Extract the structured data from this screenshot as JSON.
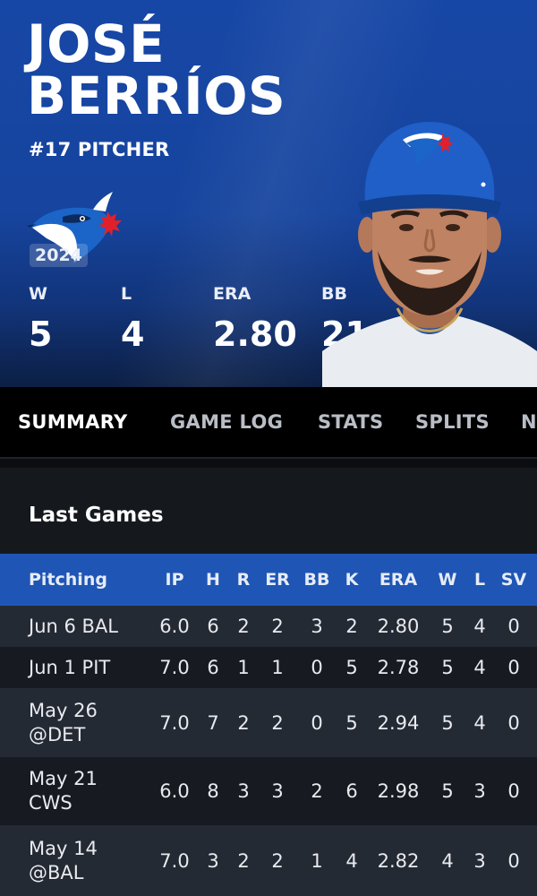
{
  "player": {
    "first_name": "JOSÉ",
    "last_name": "BERRÍOS",
    "meta": "#17 PITCHER",
    "team_logo_icon": "blue-jays-logo-icon",
    "headshot_icon": "player-headshot-icon"
  },
  "season": {
    "year": "2024"
  },
  "summary_stats": [
    {
      "label": "W",
      "value": "5"
    },
    {
      "label": "L",
      "value": "4"
    },
    {
      "label": "ERA",
      "value": "2.80"
    },
    {
      "label": "BB",
      "value": "21"
    }
  ],
  "tabs": [
    {
      "label": "SUMMARY",
      "active": true
    },
    {
      "label": "GAME LOG"
    },
    {
      "label": "STATS"
    },
    {
      "label": "SPLITS"
    },
    {
      "label": "N"
    }
  ],
  "last_games": {
    "title": "Last Games",
    "columns": [
      "Pitching",
      "IP",
      "H",
      "R",
      "ER",
      "BB",
      "K",
      "ERA",
      "W",
      "L",
      "SV"
    ],
    "rows": [
      {
        "game_lines": [
          "Jun 6 BAL"
        ],
        "cells": [
          "6.0",
          "6",
          "2",
          "2",
          "3",
          "2",
          "2.80",
          "5",
          "4",
          "0"
        ]
      },
      {
        "game_lines": [
          "Jun 1 PIT"
        ],
        "cells": [
          "7.0",
          "6",
          "1",
          "1",
          "0",
          "5",
          "2.78",
          "5",
          "4",
          "0"
        ]
      },
      {
        "game_lines": [
          "May 26",
          "@DET"
        ],
        "cells": [
          "7.0",
          "7",
          "2",
          "2",
          "0",
          "5",
          "2.94",
          "5",
          "4",
          "0"
        ]
      },
      {
        "game_lines": [
          "May 21",
          "CWS"
        ],
        "cells": [
          "6.0",
          "8",
          "3",
          "3",
          "2",
          "6",
          "2.98",
          "5",
          "3",
          "0"
        ]
      },
      {
        "game_lines": [
          "May 14",
          "@BAL"
        ],
        "cells": [
          "7.0",
          "3",
          "2",
          "2",
          "1",
          "4",
          "2.82",
          "4",
          "3",
          "0"
        ]
      }
    ]
  },
  "colors": {
    "header_blue": "#1747a6",
    "table_header_blue": "#1f56b5",
    "row_dark": "#171b21",
    "row_light": "#242a33"
  }
}
